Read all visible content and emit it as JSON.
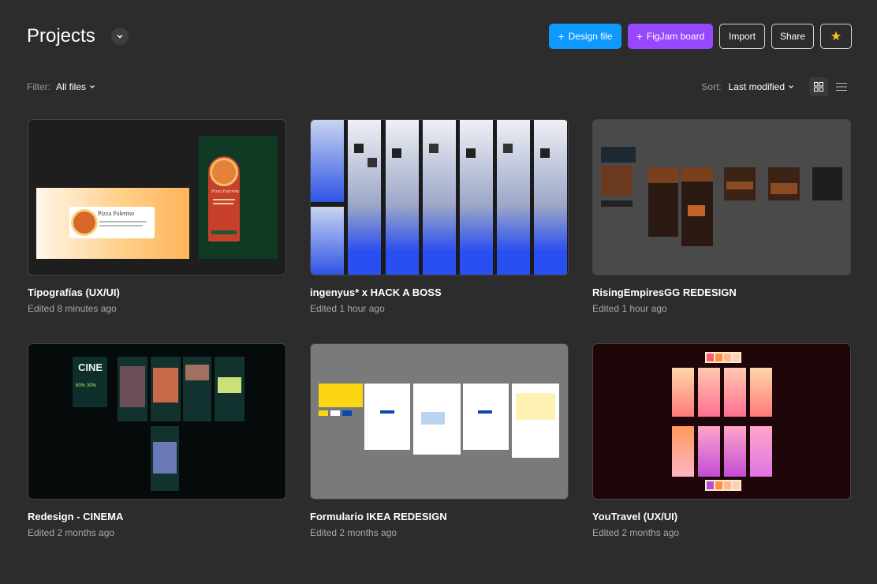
{
  "header": {
    "title": "Projects",
    "buttons": {
      "design_file": "Design file",
      "figjam_board": "FigJam board",
      "import": "Import",
      "share": "Share"
    }
  },
  "toolbar": {
    "filter_label": "Filter:",
    "filter_value": "All files",
    "sort_label": "Sort:",
    "sort_value": "Last modified"
  },
  "colors": {
    "background": "#2c2c2c",
    "design_button": "#0d99ff",
    "figjam_button": "#9747ff",
    "favorite_star": "#ffc21a"
  },
  "files": [
    {
      "name": "Tipografías (UX/UI)",
      "edited": "Edited 8 minutes ago",
      "thumb_pizza_title": "Pizza Palermo",
      "thumb_pizza_title_2": "Pizza Palermo"
    },
    {
      "name": "ingenyus* x HACK A BOSS",
      "edited": "Edited 1 hour ago"
    },
    {
      "name": "RisingEmpiresGG REDESIGN",
      "edited": "Edited 1 hour ago"
    },
    {
      "name": "Redesign - CINEMA",
      "edited": "Edited 2 months ago",
      "thumb_poster_title": "CINE",
      "thumb_poster_pct1": "60%",
      "thumb_poster_pct2": "30%"
    },
    {
      "name": "Formulario IKEA REDESIGN",
      "edited": "Edited 2 months ago"
    },
    {
      "name": "YouTravel (UX/UI)",
      "edited": "Edited 2 months ago"
    }
  ]
}
